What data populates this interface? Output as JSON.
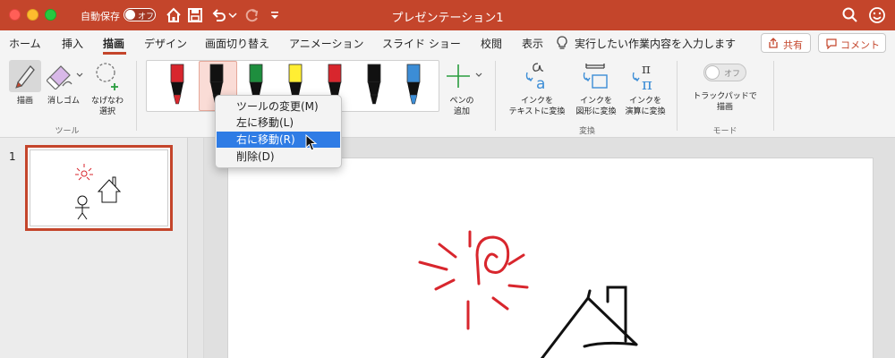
{
  "titlebar": {
    "autosave_label": "自動保存",
    "autosave_toggle": "オフ",
    "document_title": "プレゼンテーション1"
  },
  "tabs": [
    {
      "label": "ホーム"
    },
    {
      "label": "挿入"
    },
    {
      "label": "描画"
    },
    {
      "label": "デザイン"
    },
    {
      "label": "画面切り替え"
    },
    {
      "label": "アニメーション"
    },
    {
      "label": "スライド ショー"
    },
    {
      "label": "校閲"
    },
    {
      "label": "表示"
    }
  ],
  "active_tab": "描画",
  "tell_me": "実行したい作業内容を入力します",
  "share_label": "共有",
  "comment_label": "コメント",
  "ribbon": {
    "draw_label": "描画",
    "eraser_label": "消しゴム",
    "lasso_label_1": "なげなわ",
    "lasso_label_2": "選択",
    "tools_group": "ツール",
    "pens": [
      {
        "color": "#d8262d"
      },
      {
        "color": "#111111"
      },
      {
        "color": "#1e8e3e"
      },
      {
        "color": "#ffee33"
      },
      {
        "color": "#d8262d"
      },
      {
        "color": "#111111"
      },
      {
        "color": "#3c8dd6"
      }
    ],
    "add_pen_1": "ペンの",
    "add_pen_2": "追加",
    "ink_to_text_1": "インクを",
    "ink_to_text_2": "テキストに変換",
    "ink_to_shape_1": "インクを",
    "ink_to_shape_2": "図形に変換",
    "ink_to_math_1": "インクを",
    "ink_to_math_2": "演算に変換",
    "convert_group": "変換",
    "trackpad_1": "トラックパッドで",
    "trackpad_2": "描画",
    "trackpad_toggle": "オフ",
    "mode_group": "モード"
  },
  "context_menu": [
    {
      "label": "ツールの変更(M)",
      "highlighted": false
    },
    {
      "label": "左に移動(L)",
      "highlighted": false
    },
    {
      "label": "右に移動(R)",
      "highlighted": true
    },
    {
      "label": "削除(D)",
      "highlighted": false
    }
  ],
  "slides": [
    {
      "number": "1"
    }
  ],
  "colors": {
    "accent": "#c4452b",
    "menu_highlight": "#2f7ce5",
    "ink_red": "#d8262d"
  }
}
